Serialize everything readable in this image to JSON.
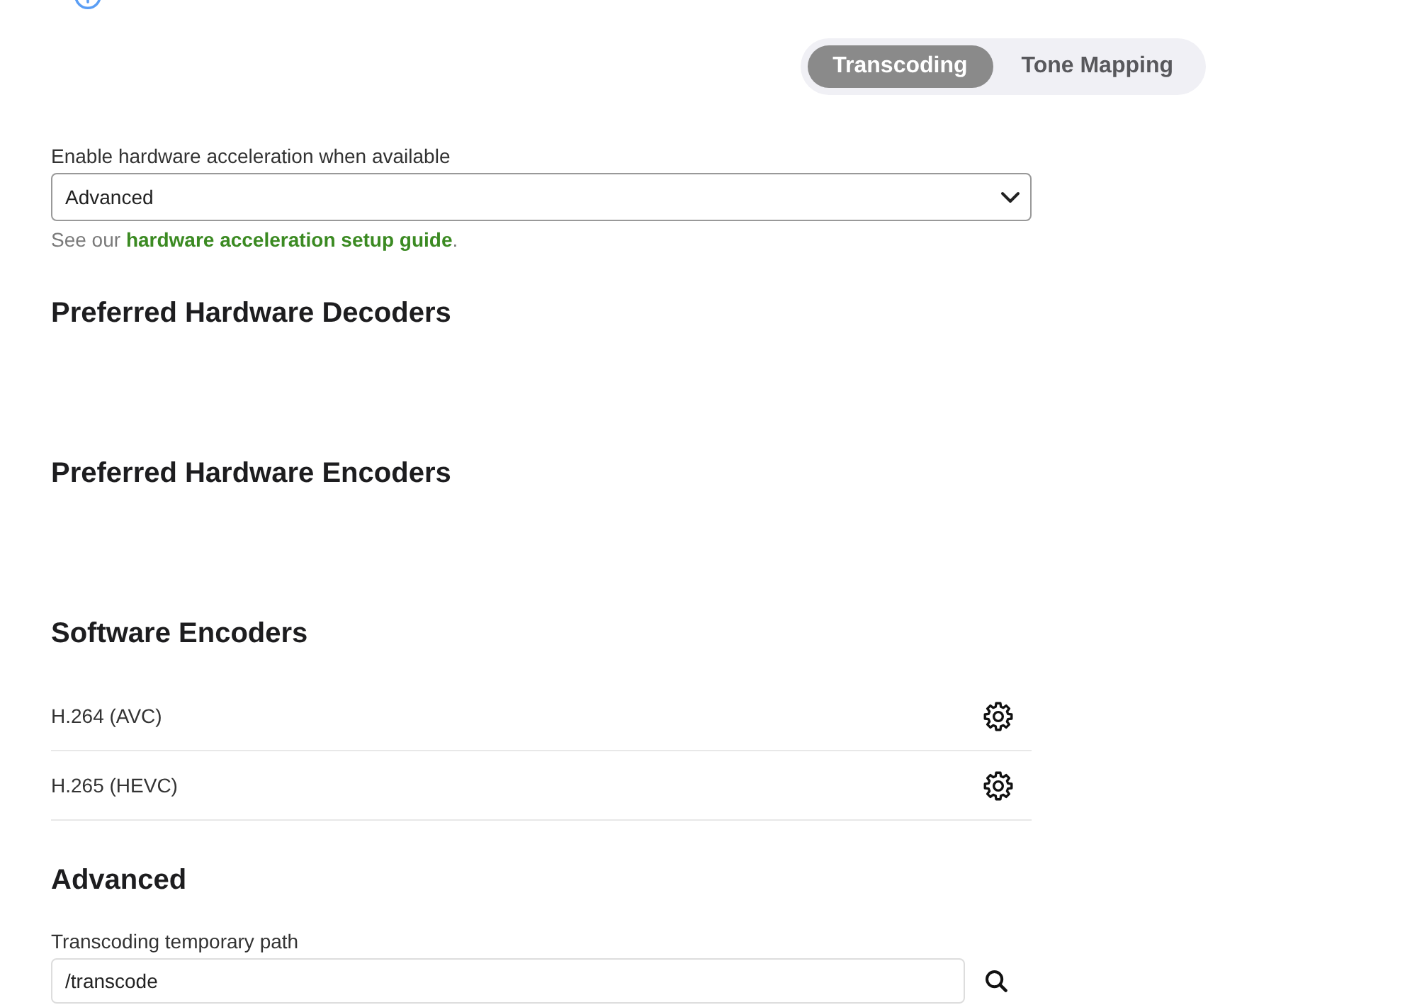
{
  "tabs": [
    {
      "label": "Transcoding",
      "selected": true
    },
    {
      "label": "Tone Mapping",
      "selected": false
    }
  ],
  "hardware_acceleration": {
    "label": "Enable hardware acceleration when available",
    "value": "Advanced",
    "help": {
      "text_before": "See our ",
      "link": "hardware acceleration setup guide",
      "text_after": "."
    }
  },
  "sections": [
    {
      "title": "Preferred Hardware Decoders"
    },
    {
      "title": "Preferred Hardware Encoders"
    },
    {
      "title": "Software Encoders",
      "items": [
        {
          "label": "H.264 (AVC)"
        },
        {
          "label": "H.265 (HEVC)"
        }
      ]
    },
    {
      "title": "Advanced",
      "fields": [
        {
          "label": "Transcoding temporary path",
          "value": "/transcode"
        }
      ]
    }
  ]
}
